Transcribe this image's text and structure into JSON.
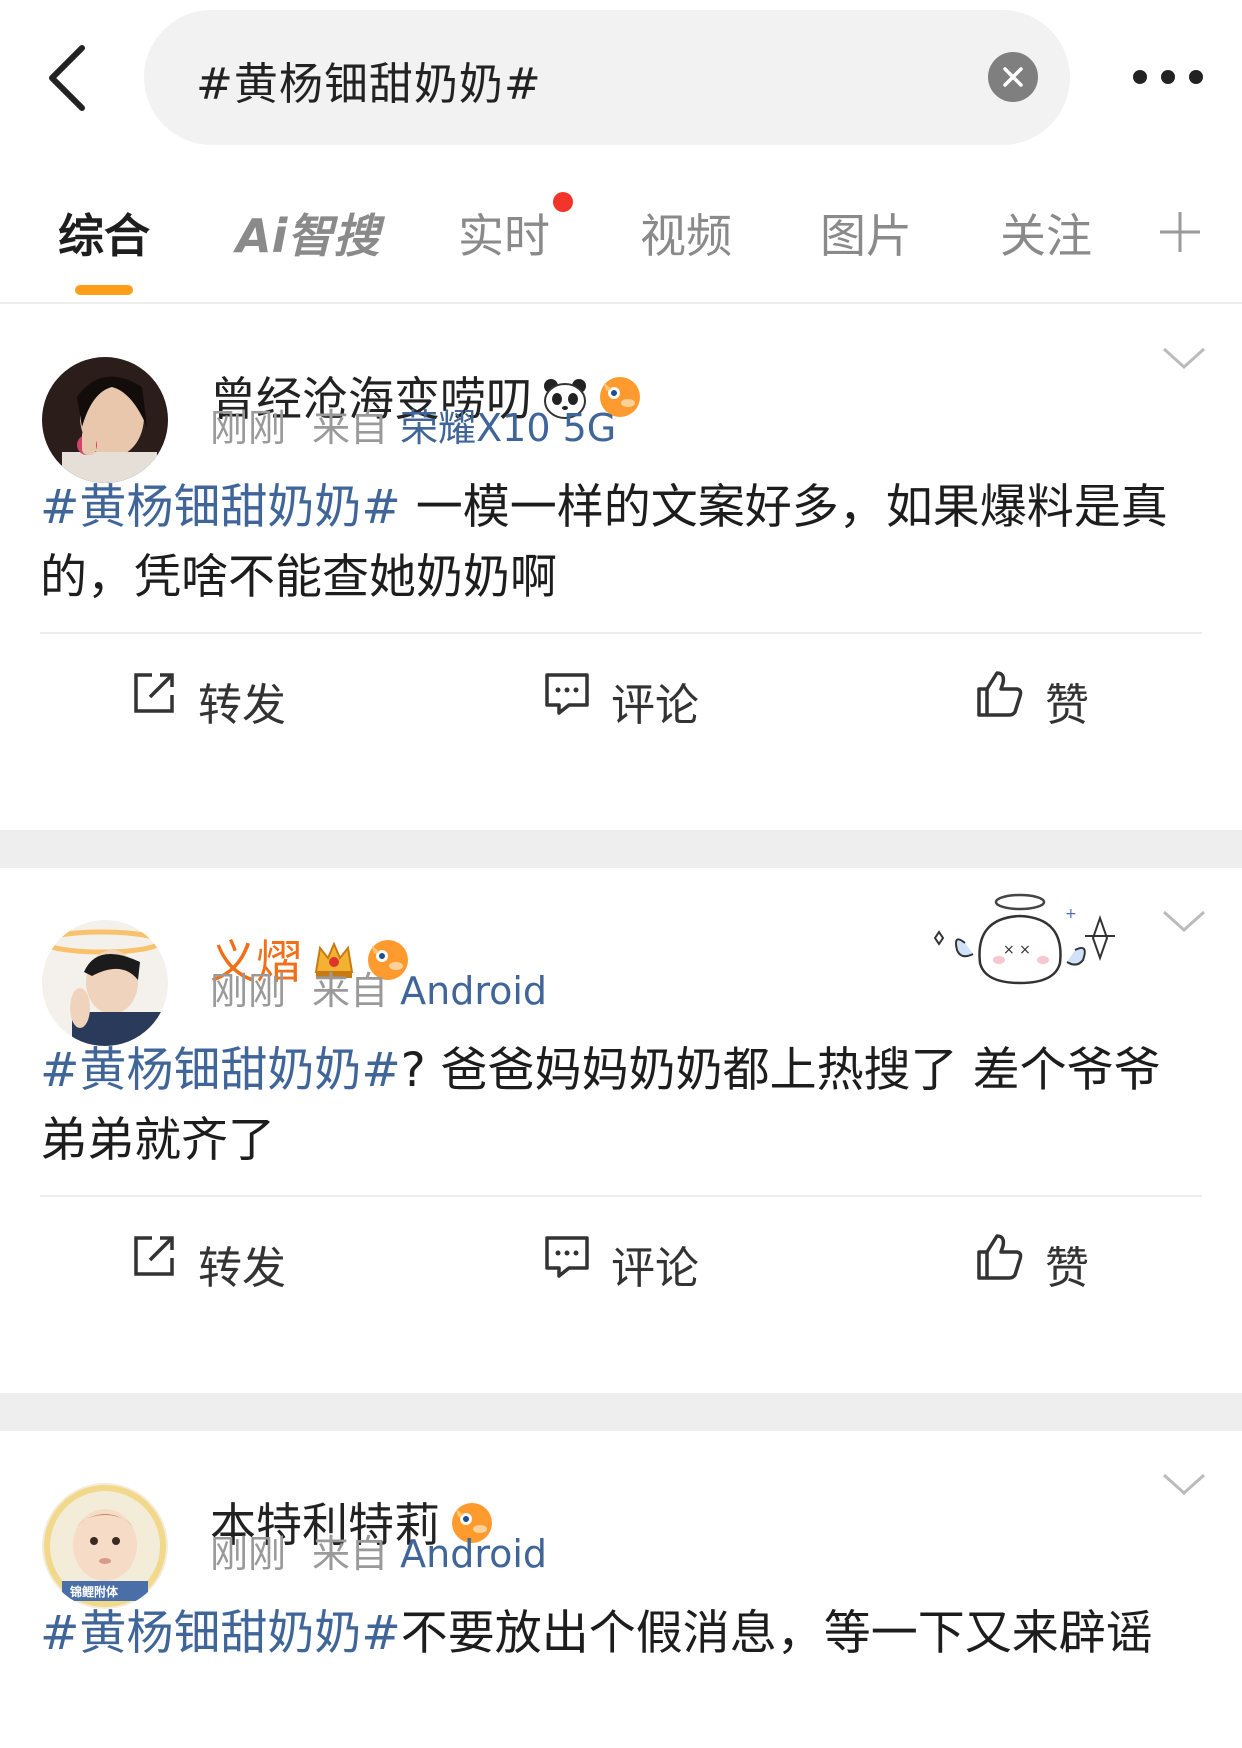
{
  "search": {
    "query": "#黄杨钿甜奶奶#"
  },
  "tabs": [
    {
      "label": "综合",
      "active": true
    },
    {
      "label": "Ai智搜",
      "active": false
    },
    {
      "label": "实时",
      "active": false,
      "dot": true
    },
    {
      "label": "视频",
      "active": false
    },
    {
      "label": "图片",
      "active": false
    },
    {
      "label": "关注",
      "active": false
    }
  ],
  "tabs_plus": "+",
  "colors": {
    "accent": "#ff9e1b",
    "link": "#406599",
    "vip_name": "#f06f18",
    "notification_dot": "#f2352a"
  },
  "posts": [
    {
      "username": "曾经沧海变唠叨",
      "time": "刚刚",
      "from_prefix": "来自",
      "source": "荣耀X10 5G",
      "topic": "#黄杨钿甜奶奶#",
      "text": " 一模一样的文案好多，如果爆料是真的，凭啥不能查她奶奶啊",
      "actions": {
        "repost": "转发",
        "comment": "评论",
        "like": "赞"
      }
    },
    {
      "username": "义熠",
      "time": "刚刚",
      "from_prefix": "来自",
      "source": "Android",
      "topic": "#黄杨钿甜奶奶#",
      "text": "? 爸爸妈妈奶奶都上热搜了 差个爷爷弟弟就齐了",
      "actions": {
        "repost": "转发",
        "comment": "评论",
        "like": "赞"
      }
    },
    {
      "username": "本特利特莉",
      "time": "刚刚",
      "from_prefix": "来自",
      "source": "Android",
      "topic": "#黄杨钿甜奶奶#",
      "text": "不要放出个假消息，等一下又来辟谣",
      "avatar_caption": "锦鲤附体"
    }
  ]
}
